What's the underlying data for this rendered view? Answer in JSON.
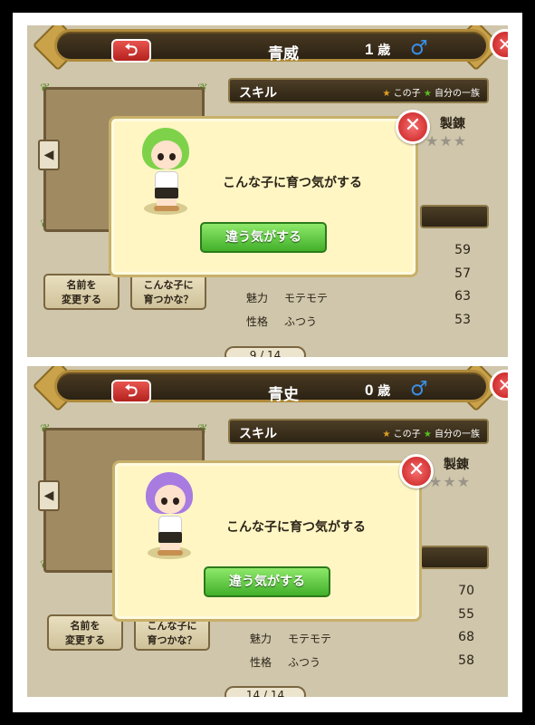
{
  "colors": {
    "hair_top": "#7ed24a",
    "hair_bottom": "#a77be0",
    "accent_green": "#42b02a",
    "close_red": "#c81c1c"
  },
  "panels": [
    {
      "header": {
        "back_label": "⮌",
        "name": "青威",
        "age": "1",
        "age_unit": "歳",
        "gender_icon": "♂"
      },
      "buttons": {
        "rename": "名前を\n変更する",
        "grow": "こんな子に\n育つかな？"
      },
      "skill": {
        "title": "スキル",
        "this_child": "この子",
        "own_clan": "自分の一族",
        "craft": "製錬"
      },
      "stats": [
        {
          "label": "",
          "value": "",
          "num": "59"
        },
        {
          "label": "",
          "value": "",
          "num": "57"
        },
        {
          "label": "魅力",
          "value": "モテモテ",
          "num": "63"
        },
        {
          "label": "性格",
          "value": "ふつう",
          "num": "53"
        }
      ],
      "pager": "9 / 14",
      "dialog": {
        "message": "こんな子に育つ気がする",
        "button": "違う気がする",
        "close_icon": "close-icon"
      }
    },
    {
      "header": {
        "back_label": "⮌",
        "name": "青史",
        "age": "0",
        "age_unit": "歳",
        "gender_icon": "♂"
      },
      "buttons": {
        "rename": "名前を\n変更する",
        "grow": "こんな子に\n育つかな？"
      },
      "skill": {
        "title": "スキル",
        "this_child": "この子",
        "own_clan": "自分の一族",
        "craft": "製錬"
      },
      "stats": [
        {
          "label": "",
          "value": "",
          "num": "70"
        },
        {
          "label": "",
          "value": "",
          "num": "55"
        },
        {
          "label": "魅力",
          "value": "モテモテ",
          "num": "68"
        },
        {
          "label": "性格",
          "value": "ふつう",
          "num": "58"
        }
      ],
      "pager": "14 / 14",
      "dialog": {
        "message": "こんな子に育つ気がする",
        "button": "違う気がする",
        "close_icon": "close-icon"
      }
    }
  ]
}
